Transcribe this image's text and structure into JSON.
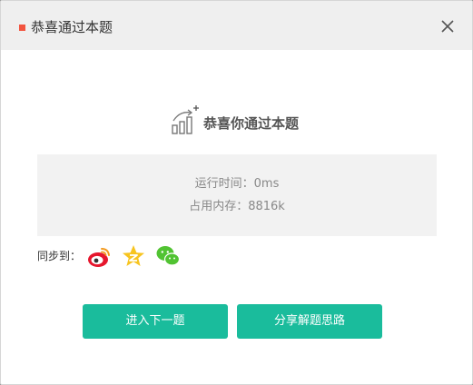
{
  "dialog": {
    "title": "恭喜通过本题",
    "accent_color": "#f2543f"
  },
  "headline": {
    "text": "恭喜你通过本题",
    "icon": "trophy-chart-icon"
  },
  "stats": {
    "runtime": "运行时间：0ms",
    "memory": "占用内存：8816k"
  },
  "share": {
    "label": "同步到：",
    "icons": [
      "weibo-icon",
      "qzone-icon",
      "wechat-icon"
    ]
  },
  "buttons": {
    "next_label": "进入下一题",
    "share_idea_label": "分享解题思路",
    "color": "#1abc9c"
  }
}
